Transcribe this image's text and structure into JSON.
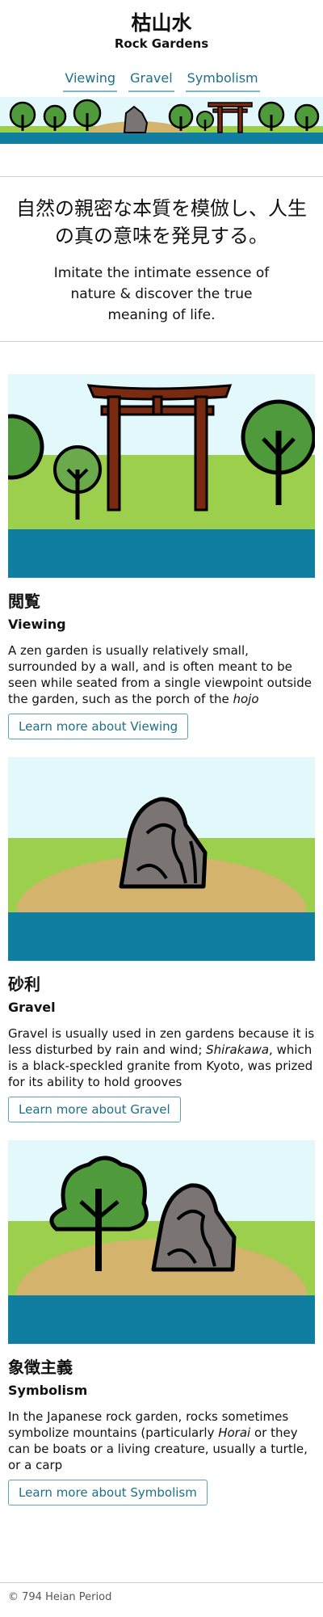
{
  "header": {
    "title": "枯山水",
    "subtitle": "Rock Gardens"
  },
  "nav": {
    "items": [
      {
        "label": "Viewing"
      },
      {
        "label": "Gravel"
      },
      {
        "label": "Symbolism"
      }
    ]
  },
  "intro": {
    "japanese": "自然の親密な本質を模倣し、人生の真の意味を発見する。",
    "english": "Imitate the intimate essence of nature & discover the true meaning of life."
  },
  "sections": [
    {
      "title_jp": "閲覧",
      "title_en": "Viewing",
      "body_before": "A zen garden is usually relatively small, surrounded by a wall, and is often meant to be seen while seated from a single viewpoint outside the garden, such as the porch of the ",
      "body_em": "hojo",
      "body_after": "",
      "button_label": "Learn more about Viewing"
    },
    {
      "title_jp": "砂利",
      "title_en": "Gravel",
      "body_before": "Gravel is usually used in zen gardens because it is less disturbed by rain and wind; ",
      "body_em": "Shirakawa",
      "body_after": ", which is a black-speckled granite from Kyoto, was prized for its ability to hold grooves",
      "button_label": "Learn more about Gravel"
    },
    {
      "title_jp": "象徴主義",
      "title_en": "Symbolism",
      "body_before": "In the Japanese rock garden, rocks sometimes symbolize mountains (particularly ",
      "body_em": "Horai",
      "body_after": " or they can be boats or a living creature, usually a turtle, or a carp",
      "button_label": "Learn more about Symbolism"
    }
  ],
  "footer": {
    "text": "© 794 Heian Period"
  },
  "colors": {
    "sky": "#e3f8fb",
    "grass": "#9ccf4b",
    "water": "#0f7ea0",
    "sand": "#d4b46c",
    "tree": "#4f9a3a",
    "rock": "#7a7472",
    "torii": "#7a2a10",
    "link": "#1d6f88"
  },
  "icons": [
    "tree-icon",
    "rock-icon",
    "torii-gate-icon"
  ]
}
